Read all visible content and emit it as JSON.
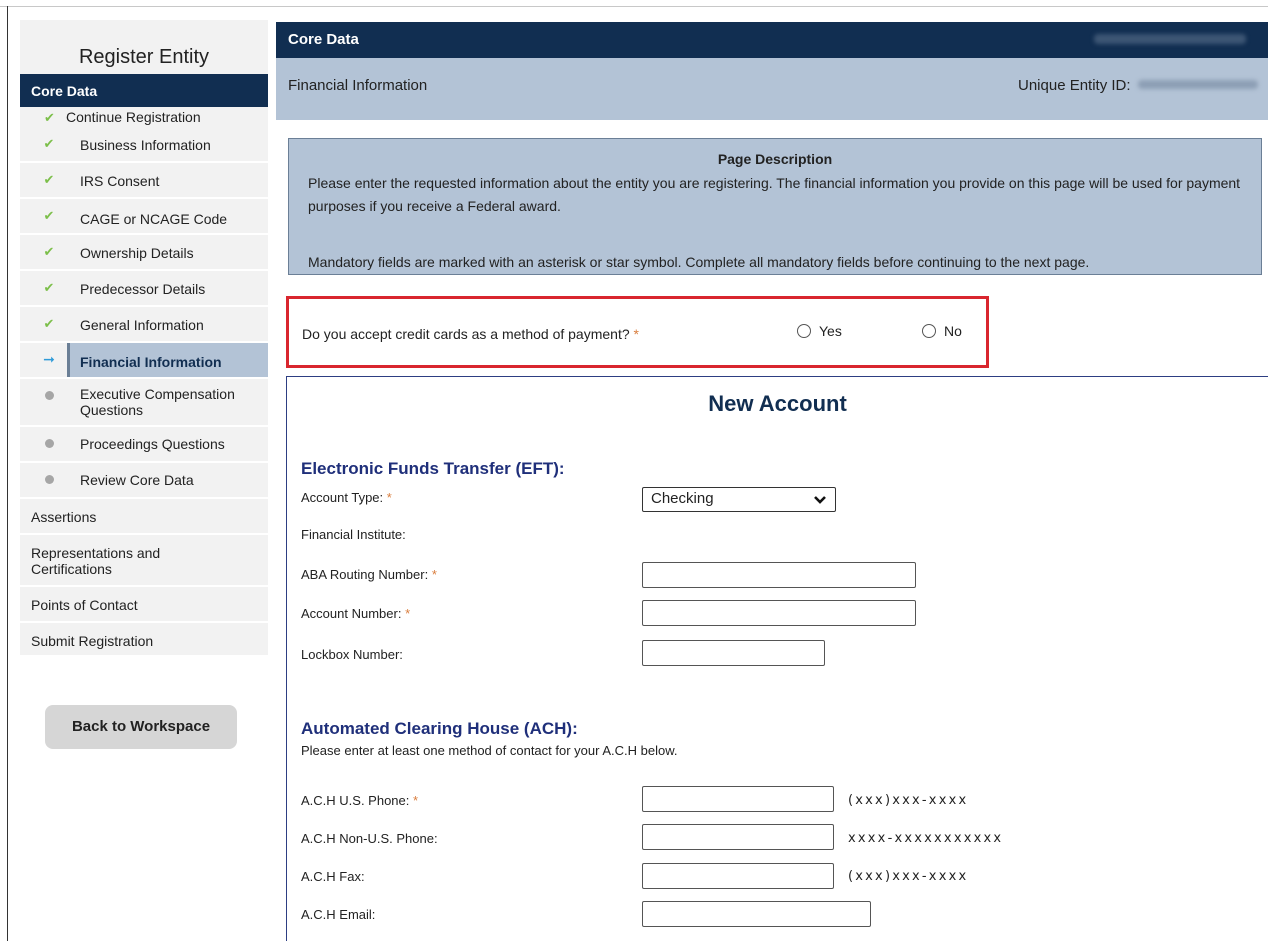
{
  "sidebar": {
    "title": "Register Entity",
    "core_data": "Core Data",
    "continue_registration": "Continue Registration",
    "steps": [
      {
        "label": "Business Information",
        "status": "complete"
      },
      {
        "label": "IRS Consent",
        "status": "complete"
      },
      {
        "label": "CAGE or NCAGE Code",
        "status": "complete"
      },
      {
        "label": "Ownership Details",
        "status": "complete"
      },
      {
        "label": "Predecessor Details",
        "status": "complete"
      },
      {
        "label": "General Information",
        "status": "complete"
      },
      {
        "label": "Financial Information",
        "status": "current"
      },
      {
        "label": "Executive Compensation Questions",
        "status": "pending"
      },
      {
        "label": "Proceedings Questions",
        "status": "pending"
      },
      {
        "label": "Review Core Data",
        "status": "pending"
      }
    ],
    "sections": [
      "Assertions",
      "Representations and Certifications",
      "Points of Contact",
      "Submit Registration"
    ],
    "back_button": "Back to Workspace"
  },
  "header": {
    "title": "Core Data",
    "subtitle": "Financial Information",
    "ueid_label": "Unique Entity ID:"
  },
  "description": {
    "title": "Page Description",
    "p1": "Please enter the requested information about the entity you are registering. The financial information you provide on this page will be used for payment purposes if you receive a Federal award.",
    "p2": "Mandatory fields are marked with an asterisk or star symbol. Complete all mandatory fields before continuing to the next page."
  },
  "credit_card": {
    "question": "Do you accept credit cards as a method of payment?",
    "required_mark": "*",
    "yes": "Yes",
    "no": "No"
  },
  "account": {
    "title": "New Account",
    "eft_heading": "Electronic Funds Transfer (EFT):",
    "account_type_label": "Account Type:",
    "account_type_value": "Checking",
    "financial_institute_label": "Financial Institute:",
    "aba_label": "ABA Routing Number:",
    "account_number_label": "Account Number:",
    "lockbox_label": "Lockbox Number:",
    "ach_heading": "Automated Clearing House (ACH):",
    "ach_note": "Please enter at least one method of contact for your A.C.H below.",
    "ach_us_phone_label": "A.C.H U.S. Phone:",
    "ach_us_phone_format": "(xxx)xxx-xxxx",
    "ach_non_us_phone_label": "A.C.H Non-U.S. Phone:",
    "ach_non_us_phone_format": "xxxx-xxxxxxxxxxx",
    "ach_fax_label": "A.C.H Fax:",
    "ach_fax_format": "(xxx)xxx-xxxx",
    "ach_email_label": "A.C.H Email:",
    "required_mark": "*"
  },
  "colors": {
    "navy": "#112e51",
    "header_light": "#b3c3d6",
    "required": "#d97d3d",
    "highlight_border": "#d9262e",
    "check": "#7cbf4a"
  }
}
